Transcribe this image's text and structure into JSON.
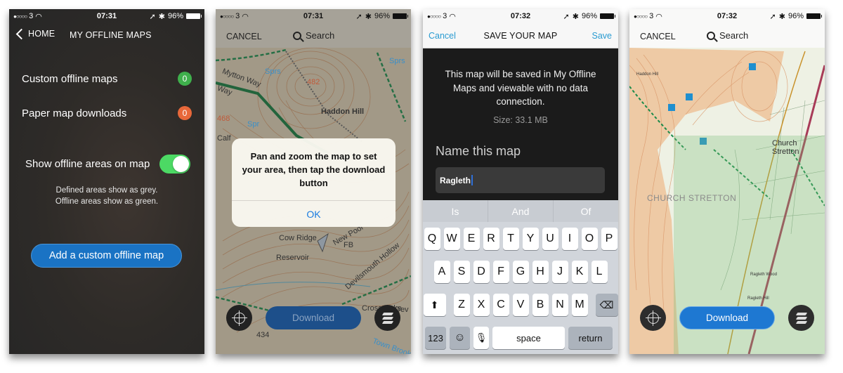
{
  "status_bars": [
    {
      "carrier": "3",
      "time": "07:31",
      "battery": "96%"
    },
    {
      "carrier": "3",
      "time": "07:31",
      "battery": "96%"
    },
    {
      "carrier": "3",
      "time": "07:32",
      "battery": "96%"
    },
    {
      "carrier": "3",
      "time": "07:32",
      "battery": "96%"
    }
  ],
  "screen1": {
    "back_label": "HOME",
    "title": "MY OFFLINE MAPS",
    "rows": [
      {
        "label": "Custom offline maps",
        "count": "0",
        "color": "#3fb04c"
      },
      {
        "label": "Paper map downloads",
        "count": "0",
        "color": "#e8683a"
      }
    ],
    "toggle_label": "Show offline areas on map",
    "toggle_on": true,
    "help_line1": "Defined areas show as grey.",
    "help_line2": "Offline areas show as green.",
    "add_button": "Add a custom offline map"
  },
  "screen2": {
    "cancel": "CANCEL",
    "search": "Search",
    "alert_message": "Pan and zoom the map to set your area, then tap the download button",
    "alert_ok": "OK",
    "download": "Download",
    "map_labels": [
      "Mytton Way",
      "Way",
      "Sprs",
      "Sprs",
      "482",
      "Haddon Hill",
      "468",
      "Spr",
      "Calf",
      "Cow Ridge",
      "FB",
      "Reservoir",
      "Devilsmouth Hollow",
      "Cross Dyke",
      "434",
      "Town Brook",
      "New Pool",
      "Dev Mo"
    ]
  },
  "screen3": {
    "cancel": "Cancel",
    "title": "SAVE YOUR MAP",
    "save": "Save",
    "info": "This map will be saved in My Offline Maps and viewable with no data connection.",
    "size": "Size: 33.1 MB",
    "name_label": "Name this map",
    "name_value": "Ragleth",
    "suggestions": [
      "Is",
      "And",
      "Of"
    ],
    "keyboard": {
      "row1": [
        "Q",
        "W",
        "E",
        "R",
        "T",
        "Y",
        "U",
        "I",
        "O",
        "P"
      ],
      "row2": [
        "A",
        "S",
        "D",
        "F",
        "G",
        "H",
        "J",
        "K",
        "L"
      ],
      "row3": [
        "Z",
        "X",
        "C",
        "V",
        "B",
        "N",
        "M"
      ],
      "numbers": "123",
      "space": "space",
      "return": "return"
    }
  },
  "screen4": {
    "cancel": "CANCEL",
    "search": "Search",
    "download": "Download",
    "map_labels": [
      "Haddon Hill",
      "Church Stretton",
      "CHURCH STRETTON",
      "Ragleth Hill",
      "Ragleth Wood"
    ]
  }
}
